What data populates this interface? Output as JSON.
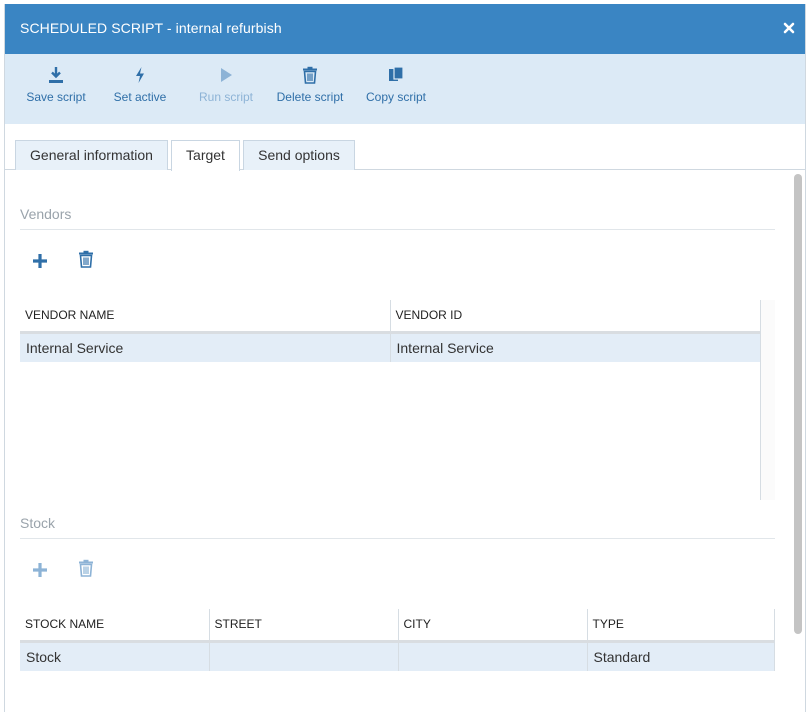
{
  "dialog": {
    "title": "SCHEDULED SCRIPT - internal refurbish",
    "close_icon": "close-icon"
  },
  "toolbar": {
    "items": [
      {
        "label": "Save script",
        "icon": "download-icon",
        "disabled": false
      },
      {
        "label": "Set active",
        "icon": "lightning-icon",
        "disabled": false
      },
      {
        "label": "Run script",
        "icon": "play-icon",
        "disabled": true
      },
      {
        "label": "Delete script",
        "icon": "trash-icon",
        "disabled": false
      },
      {
        "label": "Copy script",
        "icon": "copy-icon",
        "disabled": false
      }
    ]
  },
  "tabs": [
    {
      "label": "General information",
      "active": false
    },
    {
      "label": "Target",
      "active": true
    },
    {
      "label": "Send options",
      "active": false
    }
  ],
  "vendors": {
    "title": "Vendors",
    "columns": [
      "VENDOR NAME",
      "VENDOR ID"
    ],
    "rows": [
      [
        "Internal Service",
        "Internal Service"
      ]
    ]
  },
  "stock": {
    "title": "Stock",
    "columns": [
      "STOCK NAME",
      "STREET",
      "CITY",
      "TYPE"
    ],
    "rows": [
      [
        "Stock",
        "",
        "",
        "Standard"
      ]
    ]
  },
  "colors": {
    "titlebar": "#3a85c3",
    "toolbar_bg": "#dceaf6",
    "accent": "#2f6fa8",
    "row_selected": "#e3edf7"
  }
}
